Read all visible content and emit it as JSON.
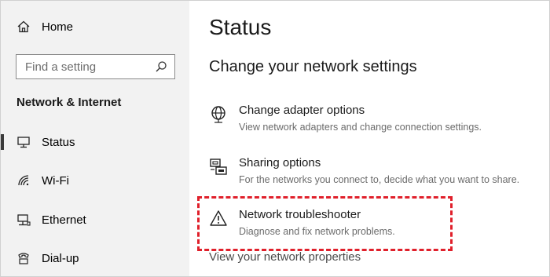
{
  "sidebar": {
    "home_label": "Home",
    "search_placeholder": "Find a setting",
    "section_title": "Network & Internet",
    "items": [
      {
        "label": "Status",
        "icon": "status-icon",
        "active": true
      },
      {
        "label": "Wi-Fi",
        "icon": "wifi-icon"
      },
      {
        "label": "Ethernet",
        "icon": "ethernet-icon"
      },
      {
        "label": "Dial-up",
        "icon": "dialup-icon"
      }
    ]
  },
  "main": {
    "title": "Status",
    "subheading": "Change your network settings",
    "options": [
      {
        "title": "Change adapter options",
        "desc": "View network adapters and change connection settings.",
        "icon": "globe-icon"
      },
      {
        "title": "Sharing options",
        "desc": "For the networks you connect to, decide what you want to share.",
        "icon": "sharing-icon"
      },
      {
        "title": "Network troubleshooter",
        "desc": "Diagnose and fix network problems.",
        "icon": "warning-icon"
      }
    ],
    "link": "View your network properties"
  },
  "colors": {
    "sidebar_bg": "#f2f2f2",
    "highlight_border": "#e0202b"
  }
}
